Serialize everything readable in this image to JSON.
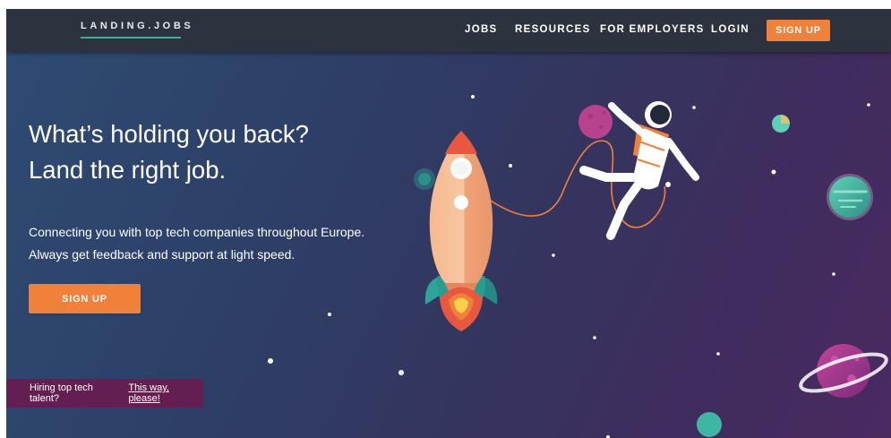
{
  "navbar": {
    "logo_text": "LANDING.JOBS",
    "links": [
      {
        "label": "JOBS"
      },
      {
        "label": "RESOURCES"
      },
      {
        "label": "FOR EMPLOYERS"
      },
      {
        "label": "LOGIN"
      }
    ],
    "signup_label": "SIGN UP"
  },
  "hero": {
    "headline_line1": "What’s holding you back?",
    "headline_line2": "Land the right job.",
    "subtext_line1": "Connecting you with top tech companies throughout Europe.",
    "subtext_line2": "Always get feedback and support at light speed.",
    "signup_label": "SIGN UP",
    "illustration": [
      "rocket-illustration",
      "astronaut-illustration",
      "planet-icon",
      "ringed-planet-icon",
      "star-icon"
    ]
  },
  "hiring_banner": {
    "text": "Hiring top tech talent?",
    "link_text": "This way, please!"
  },
  "colors": {
    "navbar_bg": "#2c323e",
    "accent_orange": "#f0813a",
    "logo_underline": "#2fb59a",
    "banner_bg": "#641f52",
    "hero_gradient_start": "#2e4b73",
    "hero_gradient_end": "#4b2a60"
  }
}
